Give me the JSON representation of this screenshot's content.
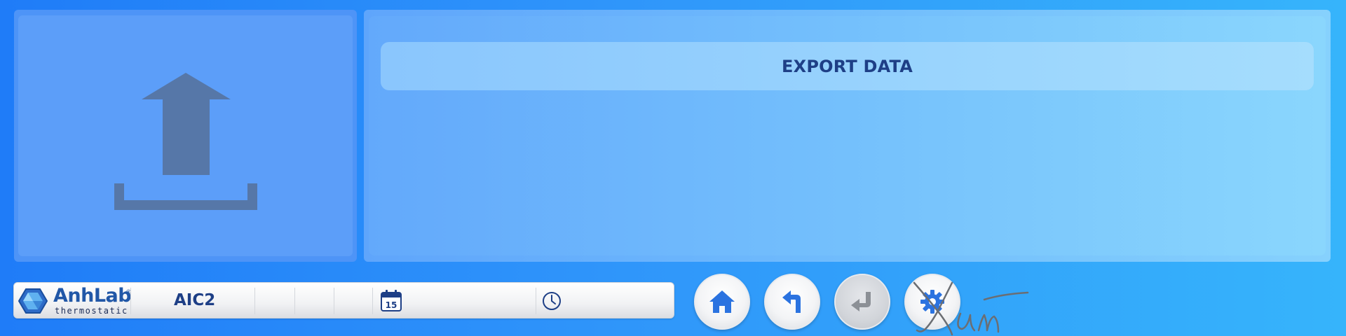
{
  "main": {
    "title": "EXPORT DATA",
    "panel_icon": "upload-icon"
  },
  "status_bar": {
    "logo": {
      "name": "AnhLab",
      "registered": "®",
      "subtitle": "thermostatic"
    },
    "device_name": "AIC2",
    "date_icon": "calendar-icon",
    "calendar_day": "15",
    "time_icon": "clock-icon"
  },
  "nav_buttons": [
    {
      "name": "home",
      "icon": "home-icon",
      "enabled": true
    },
    {
      "name": "back",
      "icon": "back-arrow-icon",
      "enabled": true
    },
    {
      "name": "enter",
      "icon": "enter-icon",
      "enabled": false
    },
    {
      "name": "settings",
      "icon": "gear-icon",
      "enabled": true
    }
  ],
  "colors": {
    "accent": "#1e3f86",
    "icon_dark": "#5677a8",
    "button_blue": "#2b73e0"
  }
}
